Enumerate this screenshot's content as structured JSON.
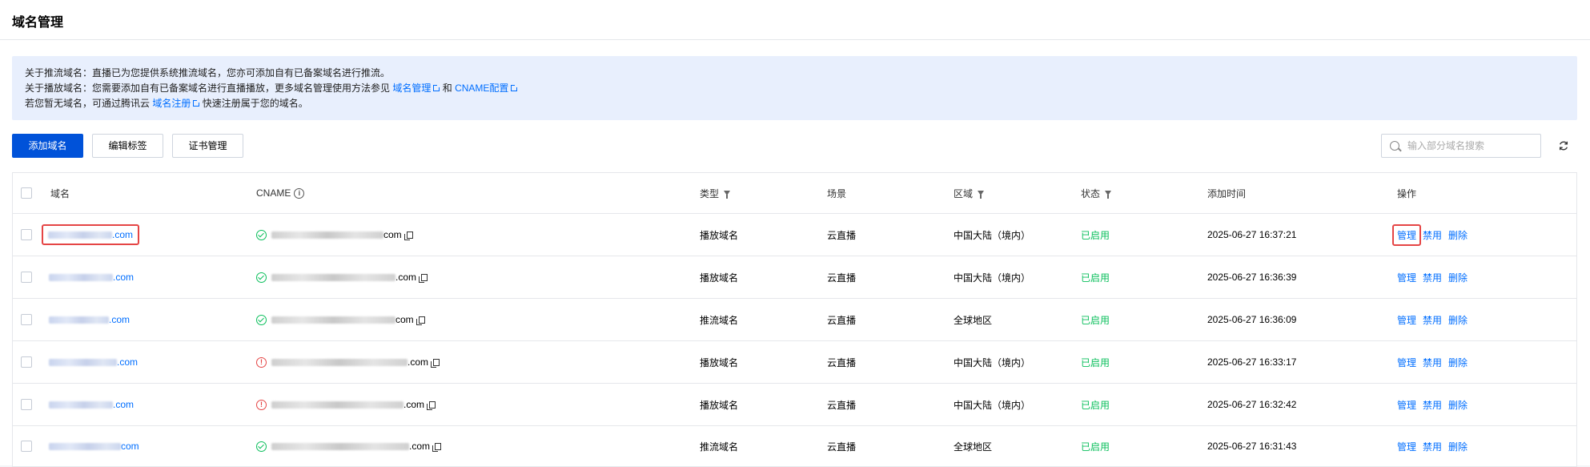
{
  "page": {
    "title": "域名管理"
  },
  "notice": {
    "line1": "关于推流域名：直播已为您提供系统推流域名，您亦可添加自有已备案域名进行推流。",
    "line2_prefix": "关于播放域名：您需要添加自有已备案域名进行直播播放，更多域名管理使用方法参见",
    "link_domain_mgmt": "域名管理",
    "and": "和",
    "link_cname": "CNAME配置",
    "line3_prefix": "若您暂无域名，可通过腾讯云",
    "link_register": "域名注册",
    "line3_suffix": "快速注册属于您的域名。"
  },
  "toolbar": {
    "add_label": "添加域名",
    "edit_tags_label": "编辑标签",
    "cert_label": "证书管理",
    "search_placeholder": "输入部分域名搜索"
  },
  "table": {
    "columns": {
      "domain": "域名",
      "cname": "CNAME",
      "type": "类型",
      "scene": "场景",
      "region": "区域",
      "status": "状态",
      "added": "添加时间",
      "ops": "操作"
    },
    "ops_labels": {
      "manage": "管理",
      "disable": "禁用",
      "delete": "删除"
    },
    "rows": [
      {
        "domain_suffix": ".com",
        "cname_suffix": "com",
        "cname_ok": true,
        "type": "播放域名",
        "scene": "云直播",
        "region": "中国大陆（境内）",
        "status": "已启用",
        "added": "2025-06-27 16:37:21"
      },
      {
        "domain_suffix": ".com",
        "cname_suffix": ".com",
        "cname_ok": true,
        "type": "播放域名",
        "scene": "云直播",
        "region": "中国大陆（境内）",
        "status": "已启用",
        "added": "2025-06-27 16:36:39"
      },
      {
        "domain_suffix": ".com",
        "cname_suffix": "com",
        "cname_ok": true,
        "type": "推流域名",
        "scene": "云直播",
        "region": "全球地区",
        "status": "已启用",
        "added": "2025-06-27 16:36:09"
      },
      {
        "domain_suffix": ".com",
        "cname_suffix": ".com",
        "cname_ok": false,
        "type": "播放域名",
        "scene": "云直播",
        "region": "中国大陆（境内）",
        "status": "已启用",
        "added": "2025-06-27 16:33:17"
      },
      {
        "domain_suffix": ".com",
        "cname_suffix": ".com",
        "cname_ok": false,
        "type": "播放域名",
        "scene": "云直播",
        "region": "中国大陆（境内）",
        "status": "已启用",
        "added": "2025-06-27 16:32:42"
      },
      {
        "domain_suffix": "com",
        "cname_suffix": ".com",
        "cname_ok": true,
        "type": "推流域名",
        "scene": "云直播",
        "region": "全球地区",
        "status": "已启用",
        "added": "2025-06-27 16:31:43"
      }
    ]
  },
  "colors": {
    "primary": "#0052d9",
    "link": "#006eff",
    "success": "#0abf5b",
    "error": "#e54545",
    "highlight": "#e54545"
  },
  "icons": {
    "ok": "check-circle-icon",
    "warn": "exclamation-circle-icon",
    "copy": "copy-icon",
    "filter": "filter-icon",
    "info": "info-icon",
    "search": "search-icon",
    "refresh": "refresh-icon",
    "external": "external-link-icon"
  }
}
